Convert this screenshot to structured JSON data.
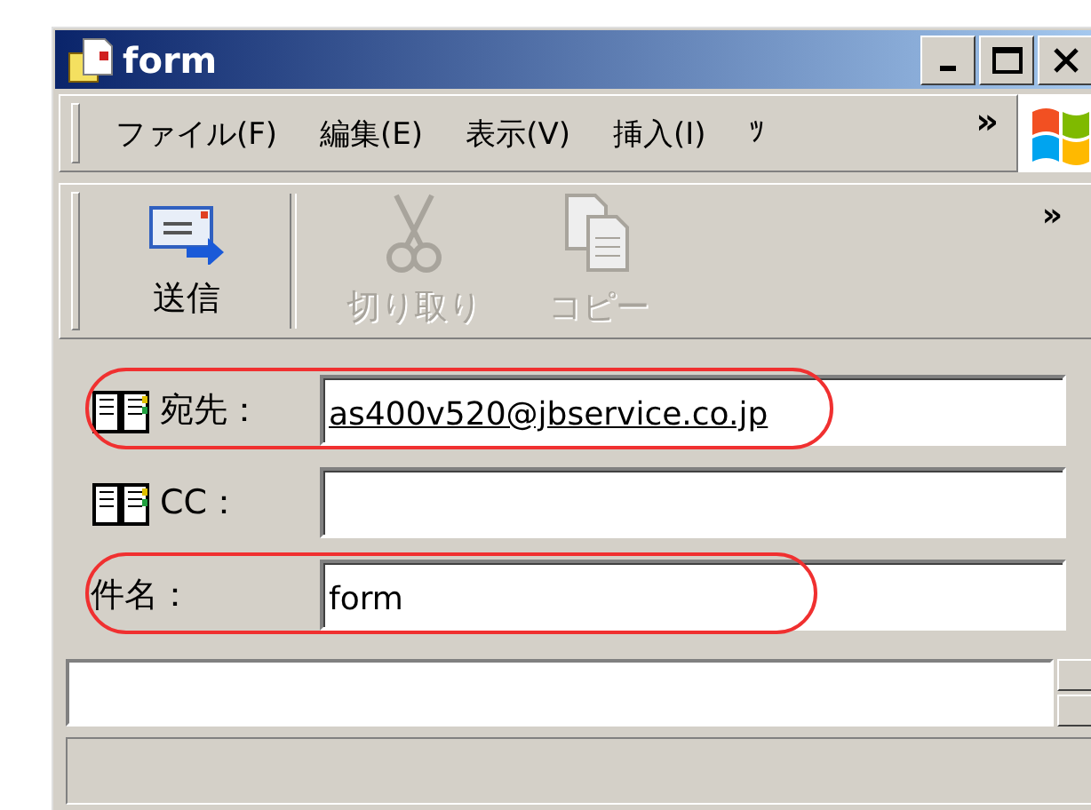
{
  "window": {
    "title": "form"
  },
  "menu": [
    {
      "label": "ファイル(F)"
    },
    {
      "label": "編集(E)"
    },
    {
      "label": "表示(V)"
    },
    {
      "label": "挿入(I)"
    },
    {
      "label": "ﾂ"
    }
  ],
  "menu_overflow": "»",
  "toolbar": [
    {
      "label": "送信",
      "kind": "send",
      "disabled": false
    },
    {
      "label": "切り取り",
      "kind": "cut",
      "disabled": true
    },
    {
      "label": "コピー",
      "kind": "copy",
      "disabled": true
    }
  ],
  "toolbar_overflow": "»",
  "fields": [
    {
      "label": "宛先：",
      "kind": "address",
      "value": "as400v520@jbservice.co.jp",
      "resolved": true,
      "highlighted": true
    },
    {
      "label": "CC：",
      "kind": "address",
      "highlighted": false
    },
    {
      "label": "件名：",
      "kind": "plain",
      "value": "form",
      "resolved": false,
      "highlighted": true
    }
  ]
}
